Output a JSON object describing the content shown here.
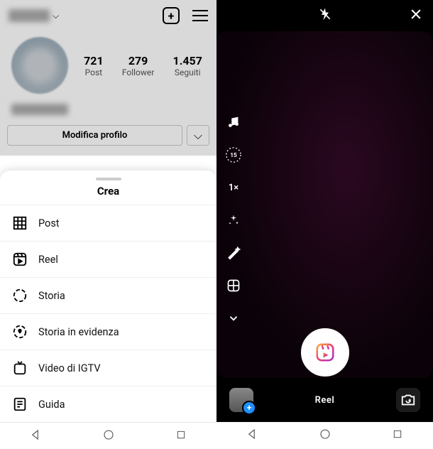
{
  "profile": {
    "stats": {
      "posts_count": "721",
      "posts_label": "Post",
      "followers_count": "279",
      "followers_label": "Follower",
      "following_count": "1.457",
      "following_label": "Seguiti"
    },
    "edit_button_label": "Modifica profilo"
  },
  "sheet": {
    "title": "Crea",
    "items": [
      {
        "label": "Post",
        "icon": "grid-icon"
      },
      {
        "label": "Reel",
        "icon": "reel-icon"
      },
      {
        "label": "Storia",
        "icon": "story-icon"
      },
      {
        "label": "Storia in evidenza",
        "icon": "highlight-icon"
      },
      {
        "label": "Video di IGTV",
        "icon": "igtv-icon"
      },
      {
        "label": "Guida",
        "icon": "guide-icon"
      }
    ]
  },
  "camera": {
    "timer_label": "15",
    "speed_label": "1×",
    "mode_label": "Reel"
  }
}
